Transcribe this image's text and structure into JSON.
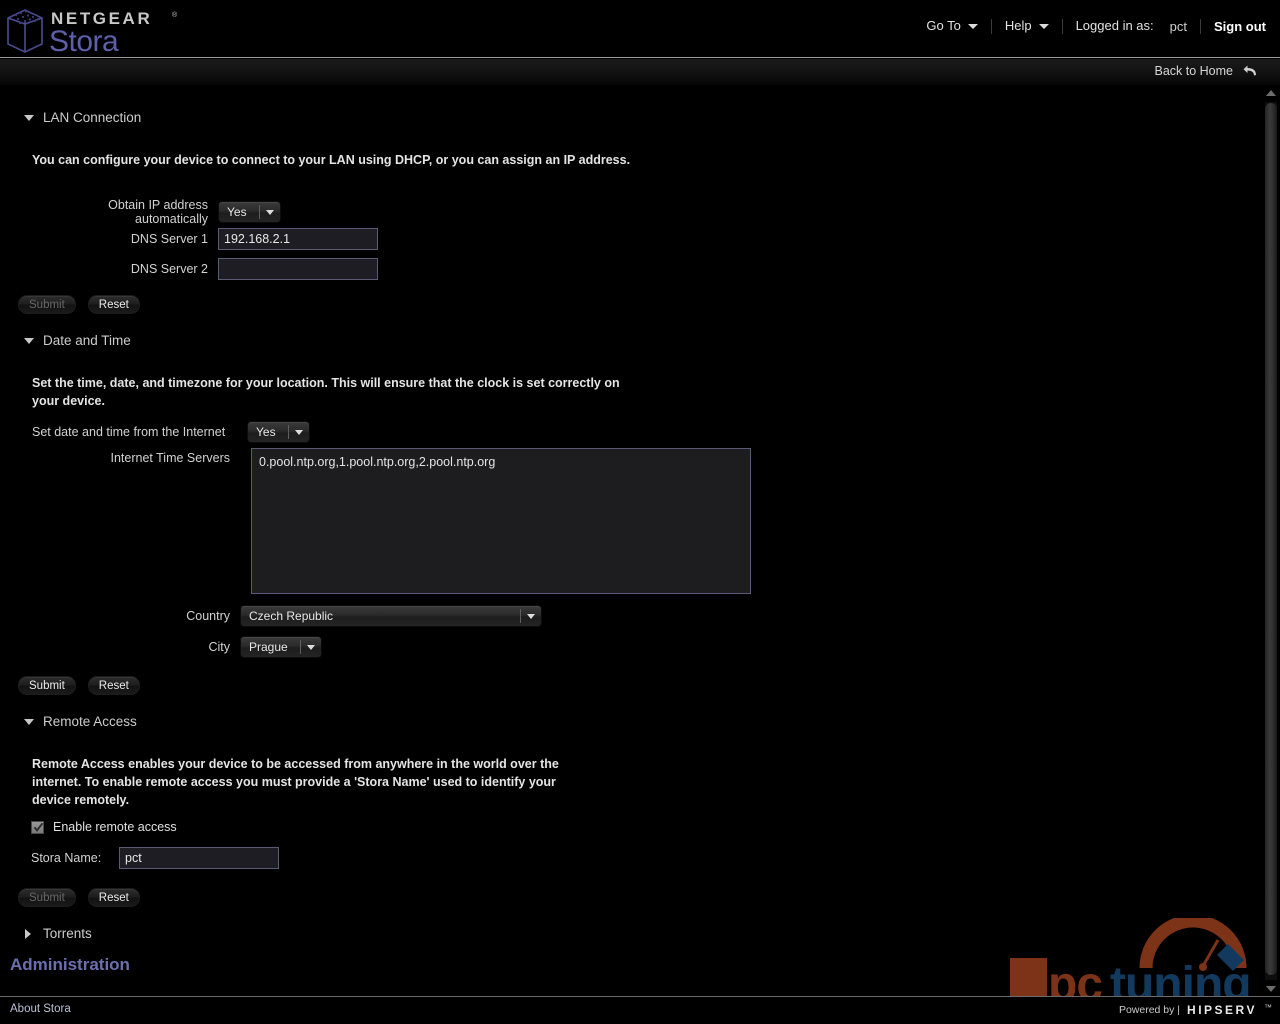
{
  "header": {
    "brand_top": "NETGEAR",
    "brand_tm": "®",
    "brand_bottom": "Stora",
    "nav": {
      "goto": "Go To",
      "help": "Help",
      "logged_in_label": "Logged in as:",
      "username": "pct",
      "sign_out": "Sign out"
    }
  },
  "subbar": {
    "back_to_home": "Back to Home"
  },
  "sections": {
    "lan": {
      "title": "LAN Connection",
      "description": "You can configure your device to connect to your LAN using DHCP, or you can assign an IP address.",
      "obtain_ip_label": "Obtain IP address automatically",
      "obtain_ip_value": "Yes",
      "dns1_label": "DNS Server 1",
      "dns1_value": "192.168.2.1",
      "dns2_label": "DNS Server 2",
      "dns2_value": "",
      "submit": "Submit",
      "reset": "Reset"
    },
    "datetime": {
      "title": "Date and Time",
      "description": "Set the time, date, and timezone for your location. This will ensure that the clock is set correctly on your device.",
      "set_from_internet_label": "Set date and time from the Internet",
      "set_from_internet_value": "Yes",
      "time_servers_label": "Internet Time Servers",
      "time_servers_value": "0.pool.ntp.org,1.pool.ntp.org,2.pool.ntp.org",
      "country_label": "Country",
      "country_value": "Czech Republic",
      "city_label": "City",
      "city_value": "Prague",
      "submit": "Submit",
      "reset": "Reset"
    },
    "remote": {
      "title": "Remote Access",
      "description": "Remote Access enables your device to be accessed from anywhere in the world over the internet. To enable remote access you must provide a 'Stora Name' used to identify your device remotely.",
      "enable_label": "Enable remote access",
      "enable_checked": true,
      "stora_name_label": "Stora Name:",
      "stora_name_value": "pct",
      "submit": "Submit",
      "reset": "Reset"
    },
    "torrents": {
      "title": "Torrents"
    },
    "administration": {
      "title": "Administration"
    }
  },
  "footer": {
    "about": "About Stora",
    "powered_by": "Powered by  |",
    "hipserv": "HIPSERV",
    "hipserv_tm": "™"
  },
  "watermark": {
    "text_pc": "pc",
    "text_tuning": "tuning"
  },
  "colors": {
    "brand_purple": "#5d5fa8",
    "admin_heading": "#6c6fae",
    "input_border": "#5a5a74",
    "input_bg": "#1d1d23",
    "watermark_red": "#7d3318",
    "watermark_blue": "#123a5e"
  }
}
